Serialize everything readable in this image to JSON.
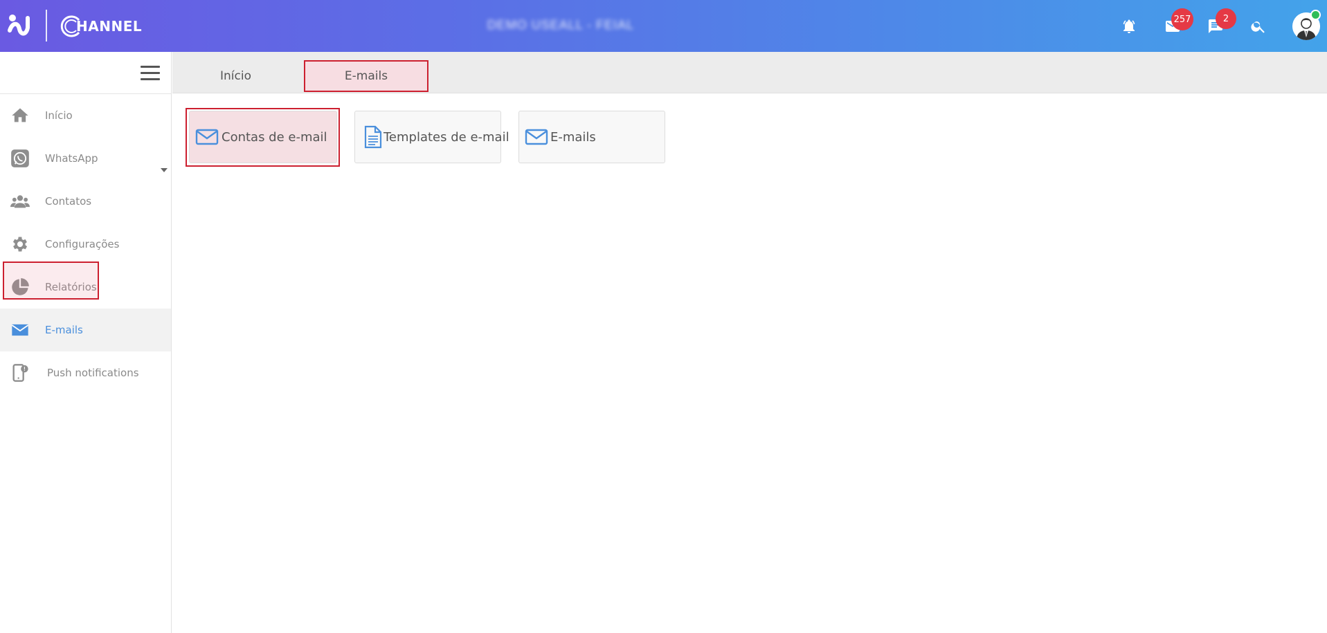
{
  "app": {
    "title": "DEMO USEALL - FEIAL",
    "logo_word": "HANNEL",
    "brand_colors": {
      "gradient_start": "#6a5ae2",
      "gradient_end": "#43a3ea",
      "badge": "#e53945",
      "accent": "#4a8fdc",
      "highlight": "#cc1f2f"
    }
  },
  "topbar": {
    "icons": [
      {
        "name": "notifications-bell-icon"
      },
      {
        "name": "mail-icon",
        "badge": "257"
      },
      {
        "name": "chat-icon",
        "badge": "2"
      },
      {
        "name": "search-icon"
      },
      {
        "name": "user-avatar",
        "status": "online"
      }
    ]
  },
  "sidebar": {
    "items": [
      {
        "label": "Início",
        "icon": "home-icon"
      },
      {
        "label": "WhatsApp",
        "icon": "whatsapp-icon"
      },
      {
        "label": "Contatos",
        "icon": "contacts-icon"
      },
      {
        "label": "Configurações",
        "icon": "gear-icon"
      },
      {
        "label": "Relatórios",
        "icon": "pie-chart-icon"
      },
      {
        "label": "E-mails",
        "icon": "envelope-icon",
        "active": true
      },
      {
        "label": "Push notifications",
        "icon": "mobile-alert-icon"
      }
    ]
  },
  "tabs": [
    {
      "label": "Início"
    },
    {
      "label": "E-mails",
      "active": true
    }
  ],
  "cards": [
    {
      "label": "Contas de e-mail",
      "icon": "envelope-icon",
      "selected": true
    },
    {
      "label": "Templates de e-mail",
      "icon": "document-icon"
    },
    {
      "label": "E-mails",
      "icon": "envelope-icon"
    }
  ]
}
